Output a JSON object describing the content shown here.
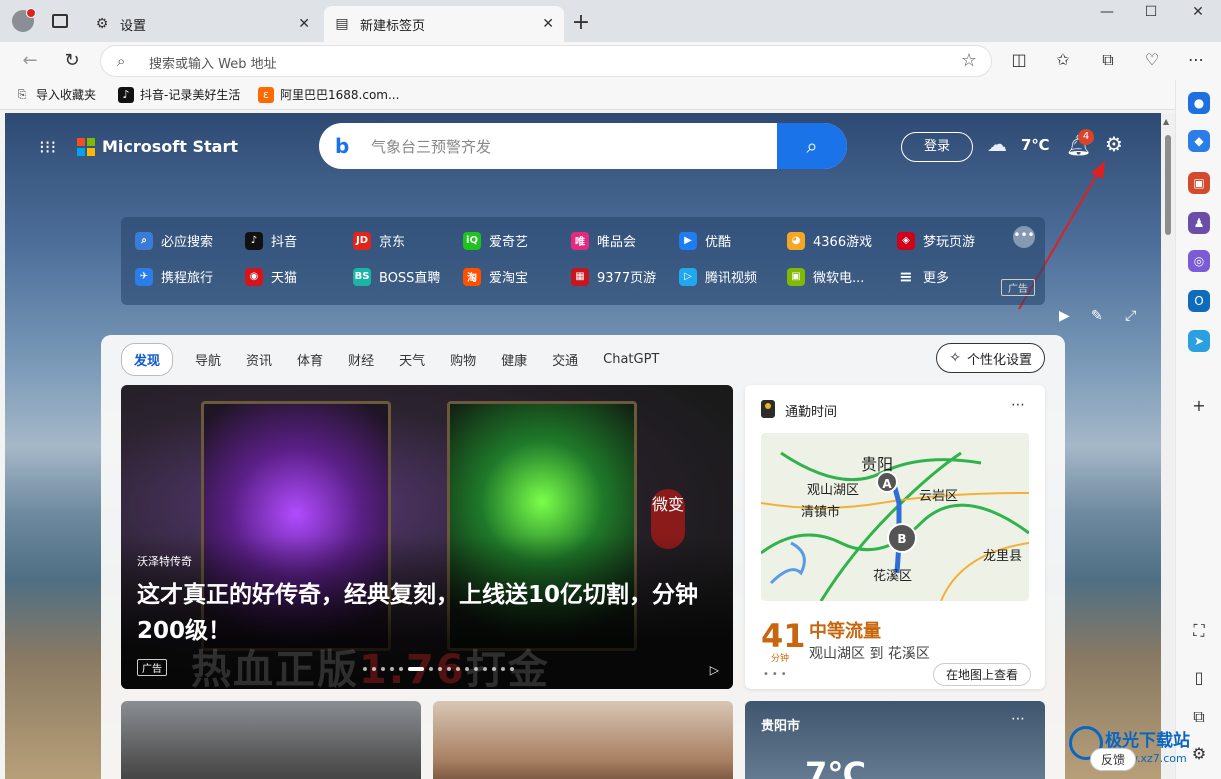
{
  "browser": {
    "tabs": [
      {
        "label": "设置",
        "active": false
      },
      {
        "label": "新建标签页",
        "active": true
      }
    ],
    "address_placeholder": "搜索或输入 Web 地址",
    "favorites": [
      {
        "label": "导入收藏夹"
      },
      {
        "label": "抖音-记录美好生活"
      },
      {
        "label": "阿里巴巴1688.com..."
      }
    ]
  },
  "header": {
    "brand": "Microsoft Start",
    "search_placeholder": "气象台三预警齐发",
    "login": "登录",
    "temperature": "7℃",
    "notification_count": "4"
  },
  "quick_links": [
    {
      "label": "必应搜索",
      "color": "#3a7bd5"
    },
    {
      "label": "抖音",
      "color": "#111111"
    },
    {
      "label": "京东",
      "color": "#e1251b"
    },
    {
      "label": "爱奇艺",
      "color": "#1ec41e"
    },
    {
      "label": "唯品会",
      "color": "#e6287e"
    },
    {
      "label": "优酷",
      "color": "#1e7cf5"
    },
    {
      "label": "4366游戏",
      "color": "#f5a623"
    },
    {
      "label": "梦玩页游",
      "color": "#d0021b"
    },
    {
      "label": "携程旅行",
      "color": "#2b7de9"
    },
    {
      "label": "天猫",
      "color": "#d4151c"
    },
    {
      "label": "BOSS直聘",
      "color": "#1ab5a5"
    },
    {
      "label": "爱淘宝",
      "color": "#ff5000"
    },
    {
      "label": "9377页游",
      "color": "#c9151e"
    },
    {
      "label": "腾讯视频",
      "color": "#20a7f0"
    },
    {
      "label": "微软电...",
      "color": "#7fba00"
    },
    {
      "label": "更多",
      "color": "#ffffff"
    }
  ],
  "quick_ad": "广告",
  "feed": {
    "tabs": [
      "发现",
      "导航",
      "资讯",
      "体育",
      "财经",
      "天气",
      "购物",
      "健康",
      "交通",
      "ChatGPT"
    ],
    "personalize": "个性化设置",
    "hero": {
      "source": "沃泽特传奇",
      "headline": "这才真正的好传奇，经典复刻，上线送10亿切割，分钟200级！",
      "ad": "广告",
      "badge": "微变",
      "watermark_a": "热血正版",
      "watermark_b": "1.76",
      "watermark_c": "打金"
    },
    "traffic": {
      "title": "通勤时间",
      "map_labels": [
        "贵阳",
        "观山湖区",
        "清镇市",
        "云岩区",
        "龙里县",
        "花溪区"
      ],
      "pin_a": "A",
      "pin_b": "B",
      "minutes": "41",
      "minutes_unit": "分钟",
      "status": "中等流量",
      "route": "观山湖区 到 花溪区",
      "view_on_map": "在地图上查看"
    },
    "weather": {
      "city": "贵阳市",
      "temp": "7℃"
    }
  },
  "footer": {
    "feedback": "反馈",
    "watermark": "极光下载站",
    "watermark_url": "www.xz7.com"
  }
}
